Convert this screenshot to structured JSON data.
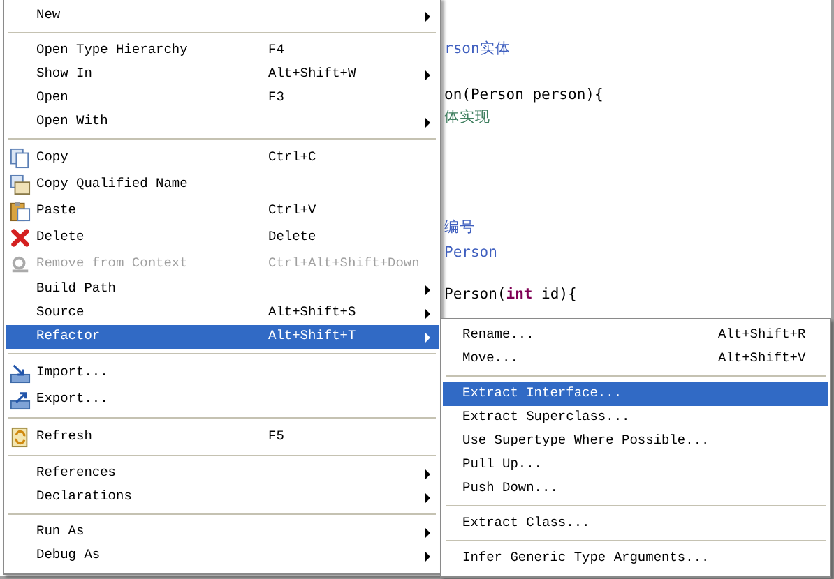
{
  "editor": {
    "code_lines": [
      {
        "spans": [
          {
            "text": "rson实体",
            "kind": "comment"
          }
        ]
      },
      {
        "spans": [
          {
            "text": "on(Person person){",
            "kind": "code"
          }
        ]
      },
      {
        "spans": [
          {
            "text": "体实现",
            "kind": "note"
          }
        ]
      },
      {
        "spans": [
          {
            "text": "编号",
            "kind": "comment"
          }
        ]
      },
      {
        "spans": [
          {
            "text": "Person",
            "kind": "comment"
          }
        ]
      },
      {
        "spans": [
          {
            "text": "Person(",
            "kind": "code"
          },
          {
            "text": "int",
            "kind": "keyword"
          },
          {
            "text": " id){",
            "kind": "code"
          }
        ]
      }
    ]
  },
  "context_menu": {
    "sections": [
      [
        {
          "label": "New",
          "has_submenu": true,
          "disabled": false,
          "selected": false
        }
      ],
      [
        {
          "label": "Open Type Hierarchy",
          "shortcut": "F4",
          "has_submenu": false,
          "disabled": false,
          "selected": false
        },
        {
          "label": "Show In",
          "shortcut": "Alt+Shift+W",
          "has_submenu": true,
          "disabled": false,
          "selected": false
        },
        {
          "label": "Open",
          "shortcut": "F3",
          "has_submenu": false,
          "disabled": false,
          "selected": false
        },
        {
          "label": "Open With",
          "has_submenu": true,
          "disabled": false,
          "selected": false
        }
      ],
      [
        {
          "label": "Copy",
          "shortcut": "Ctrl+C",
          "has_submenu": false,
          "disabled": false,
          "selected": false
        },
        {
          "label": "Copy Qualified Name",
          "has_submenu": false,
          "disabled": false,
          "selected": false
        },
        {
          "label": "Paste",
          "shortcut": "Ctrl+V",
          "has_submenu": false,
          "disabled": false,
          "selected": false
        },
        {
          "label": "Delete",
          "shortcut": "Delete",
          "has_submenu": false,
          "disabled": false,
          "selected": false
        },
        {
          "label": "Remove from Context",
          "shortcut": "Ctrl+Alt+Shift+Down",
          "has_submenu": false,
          "disabled": true,
          "selected": false
        },
        {
          "label": "Build Path",
          "has_submenu": true,
          "disabled": false,
          "selected": false
        },
        {
          "label": "Source",
          "shortcut": "Alt+Shift+S",
          "has_submenu": true,
          "disabled": false,
          "selected": false
        },
        {
          "label": "Refactor",
          "shortcut": "Alt+Shift+T",
          "has_submenu": true,
          "disabled": false,
          "selected": true
        }
      ],
      [
        {
          "label": "Import...",
          "has_submenu": false,
          "disabled": false,
          "selected": false
        },
        {
          "label": "Export...",
          "has_submenu": false,
          "disabled": false,
          "selected": false
        }
      ],
      [
        {
          "label": "Refresh",
          "shortcut": "F5",
          "has_submenu": false,
          "disabled": false,
          "selected": false
        }
      ],
      [
        {
          "label": "References",
          "has_submenu": true,
          "disabled": false,
          "selected": false
        },
        {
          "label": "Declarations",
          "has_submenu": true,
          "disabled": false,
          "selected": false
        }
      ],
      [
        {
          "label": "Run As",
          "has_submenu": true,
          "disabled": false,
          "selected": false
        },
        {
          "label": "Debug As",
          "has_submenu": true,
          "disabled": false,
          "selected": false
        }
      ]
    ]
  },
  "refactor_submenu": {
    "sections": [
      [
        {
          "label": "Rename...",
          "shortcut": "Alt+Shift+R",
          "selected": false
        },
        {
          "label": "Move...",
          "shortcut": "Alt+Shift+V",
          "selected": false
        }
      ],
      [
        {
          "label": "Extract Interface...",
          "selected": true
        },
        {
          "label": "Extract Superclass...",
          "selected": false
        },
        {
          "label": "Use Supertype Where Possible...",
          "selected": false
        },
        {
          "label": "Pull Up...",
          "selected": false
        },
        {
          "label": "Push Down...",
          "selected": false
        }
      ],
      [
        {
          "label": "Extract Class...",
          "selected": false
        }
      ],
      [
        {
          "label": "Infer Generic Type Arguments...",
          "selected": false
        }
      ]
    ]
  }
}
